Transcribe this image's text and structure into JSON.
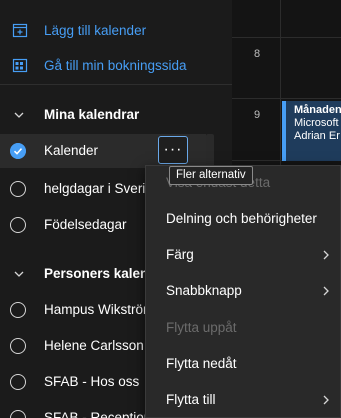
{
  "actions": [
    {
      "label": "Lägg till kalender",
      "icon": "calendar-add-icon"
    },
    {
      "label": "Gå till min bokningssida",
      "icon": "booking-page-icon"
    }
  ],
  "groups": [
    {
      "label": "Mina kalendrar",
      "items": [
        {
          "label": "Kalender",
          "checked": true
        },
        {
          "label": "helgdagar i Sverige",
          "checked": false
        },
        {
          "label": "Födelsedagar",
          "checked": false
        }
      ]
    },
    {
      "label": "Personers kalendrar",
      "items": [
        {
          "label": "Hampus Wikström",
          "checked": false
        },
        {
          "label": "Helene Carlsson",
          "checked": false
        },
        {
          "label": "SFAB - Hos oss",
          "checked": false
        },
        {
          "label": "SFAB - Reception",
          "checked": false
        }
      ]
    }
  ],
  "more_button": {
    "label": "···"
  },
  "tooltip": {
    "text": "Fler alternativ"
  },
  "grid": {
    "hours": [
      "8",
      "9"
    ],
    "event": {
      "title": "Månadens",
      "line2": "Microsoft",
      "line3": "Adrian Er"
    }
  },
  "menu": {
    "items": [
      {
        "label": "Visa endast detta",
        "disabled": true,
        "submenu": false
      },
      {
        "label": "Delning och behörigheter",
        "disabled": false,
        "submenu": false
      },
      {
        "label": "Färg",
        "disabled": false,
        "submenu": true
      },
      {
        "label": "Snabbknapp",
        "disabled": false,
        "submenu": true
      },
      {
        "label": "Flytta uppåt",
        "disabled": true,
        "submenu": false
      },
      {
        "label": "Flytta nedåt",
        "disabled": false,
        "submenu": false
      },
      {
        "label": "Flytta till",
        "disabled": false,
        "submenu": true
      }
    ]
  },
  "colors": {
    "accent": "#479ef5",
    "background": "#1b1b1b",
    "menu": "#292929"
  }
}
